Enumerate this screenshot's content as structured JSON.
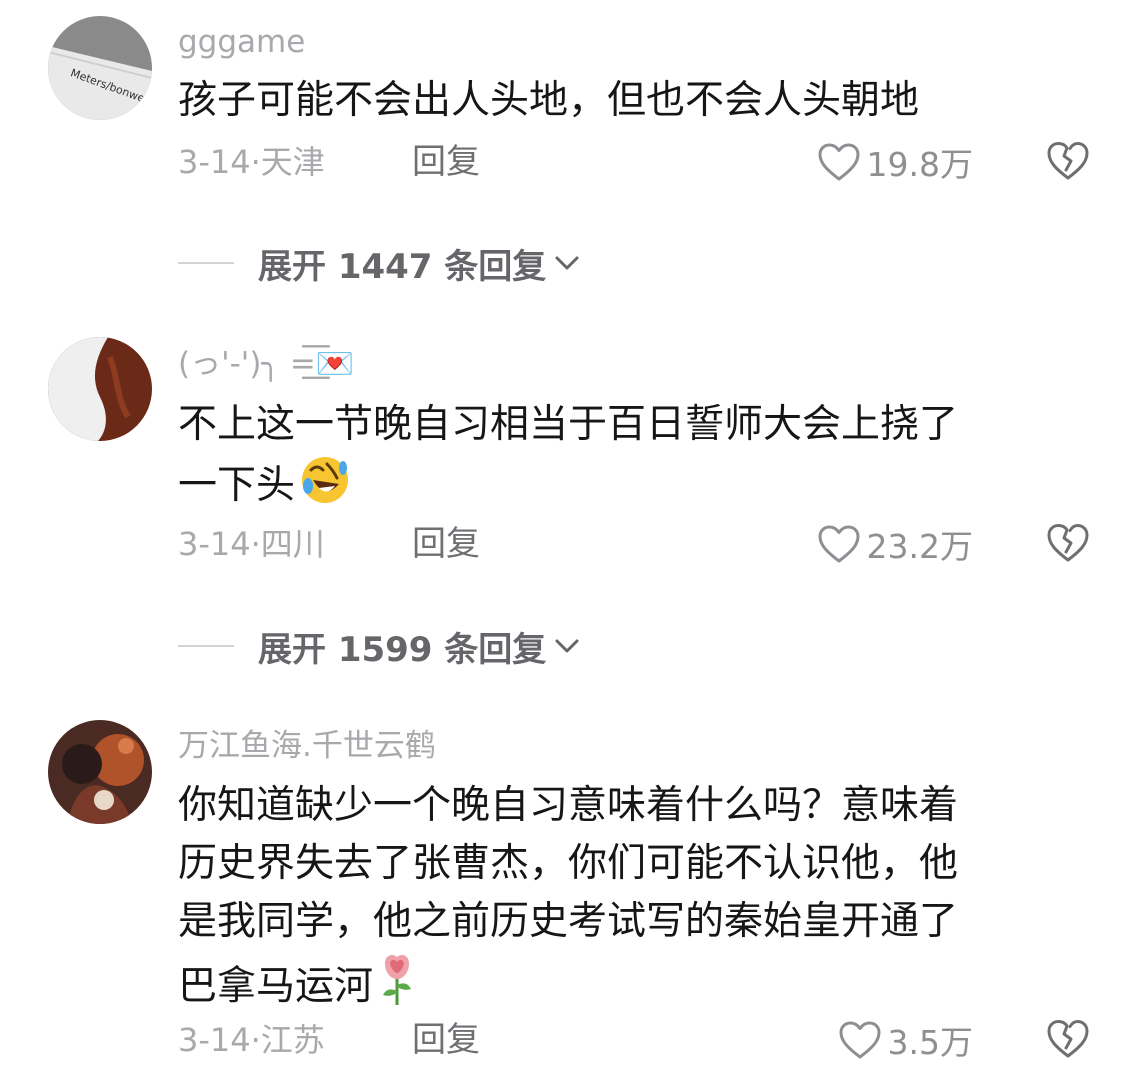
{
  "comments": [
    {
      "username": "gggame",
      "lines": [
        "孩子可能不会出人头地，但也不会人头朝地"
      ],
      "date": "3-14",
      "location": "天津",
      "reply_label": "回复",
      "likes": "19.8万",
      "avatar_text": "Meters/bonwe",
      "expand_label": "展开 1447 条回复"
    },
    {
      "username": "(っ'-')╮ =͟͟͞͞💌",
      "lines": [
        "不上这一节晚自习相当于百日誓师大会上挠了",
        "一下头"
      ],
      "date": "3-14",
      "location": "四川",
      "reply_label": "回复",
      "likes": "23.2万",
      "expand_label": "展开 1599 条回复"
    },
    {
      "username": "万江鱼海.千世云鹤",
      "lines": [
        "你知道缺少一个晚自习意味着什么吗？意味着",
        "历史界失去了张曹杰，你们可能不认识他，他",
        "是我同学，他之前历史考试写的秦始皇开通了",
        "巴拿马运河"
      ],
      "date": "3-14",
      "location": "江苏",
      "reply_label": "回复",
      "likes": "3.5万"
    }
  ],
  "icons": {
    "like": "heart-outline-icon",
    "dislike": "broken-heart-icon",
    "expand": "chevron-down-icon",
    "emoji_laugh": "rolling-laughing-emoji",
    "emoji_rose": "rose-emoji"
  },
  "colors": {
    "text": "#161616",
    "muted": "#a9a9ad",
    "reply": "#6f6f73"
  }
}
